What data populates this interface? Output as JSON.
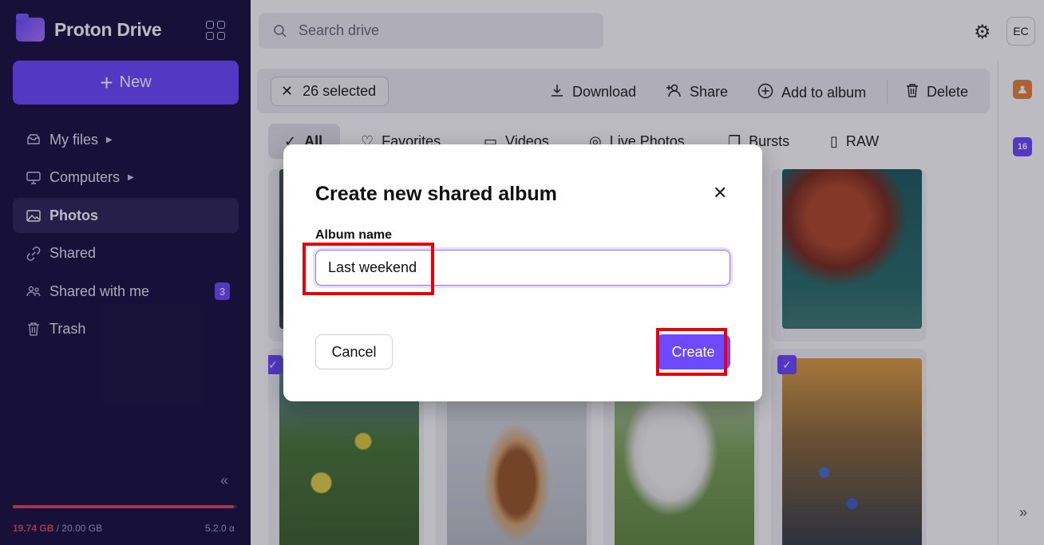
{
  "app": {
    "name": "Proton Drive",
    "new_label": "New"
  },
  "sidebar": {
    "items": [
      {
        "label": "My files",
        "icon": "drive-icon",
        "caret": "▶"
      },
      {
        "label": "Computers",
        "icon": "computer-icon",
        "caret": "▶"
      },
      {
        "label": "Photos",
        "icon": "photos-icon",
        "active": true
      },
      {
        "label": "Shared",
        "icon": "link-icon"
      },
      {
        "label": "Shared with me",
        "icon": "users-icon",
        "badge": "3"
      },
      {
        "label": "Trash",
        "icon": "trash-icon"
      }
    ],
    "collapse_glyph": "«",
    "storage": {
      "used": "19.74 GB",
      "separator": " / ",
      "total": "20.00 GB",
      "used_fraction": 0.987
    },
    "version": "5.2.0 α"
  },
  "header": {
    "search_placeholder": "Search drive",
    "avatar_initials": "EC"
  },
  "toolbar": {
    "selected_label": "26 selected",
    "download": "Download",
    "share": "Share",
    "add_to_album": "Add to album",
    "delete": "Delete"
  },
  "filters": [
    {
      "label": "All",
      "active": true
    },
    {
      "label": "Favorites"
    },
    {
      "label": "Videos"
    },
    {
      "label": "Live Photos"
    },
    {
      "label": "Bursts"
    },
    {
      "label": "RAW"
    }
  ],
  "right_rail": {
    "calendar_day": "16",
    "expand_glyph": "»"
  },
  "modal": {
    "title": "Create new shared album",
    "close_glyph": "✕",
    "field_label": "Album name",
    "field_value": "Last weekend",
    "cancel": "Cancel",
    "create": "Create"
  },
  "colors": {
    "brand": "#6d4aff",
    "sidebar_bg": "#1b1340",
    "highlight": "#e6000a",
    "storage_warning": "#e04660"
  }
}
